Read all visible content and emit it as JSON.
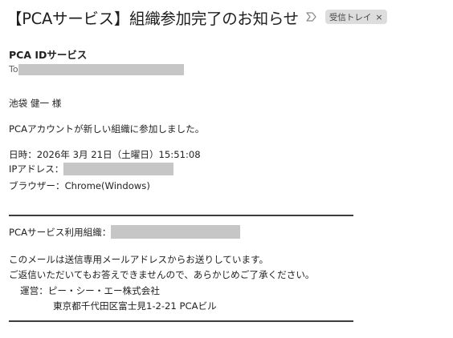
{
  "subject": "【PCAサービス】組織参加完了のお知らせ",
  "label_chip": {
    "text": "受信トレイ",
    "remove": "×"
  },
  "sender": {
    "name": "PCA IDサービス",
    "to_label": "To"
  },
  "body": {
    "greeting": "池袋 健一 様",
    "message": "PCAアカウントが新しい組織に参加しました。",
    "datetime": "日時：2026年 3月 21日（土曜日）15:51:08",
    "ip_label": "IPアドレス：",
    "browser": "ブラウザー：Chrome(Windows)",
    "org_label": "PCAサービス利用組織：",
    "notice_1": "このメールは送信専用メールアドレスからお送りしています。",
    "notice_2": "ご返信いただいてもお答えできませんので、あらかじめご了承ください。",
    "operator": "運営：ピー・シー・エー株式会社",
    "address": "東京都千代田区富士見1-2-21 PCAビル"
  },
  "colors": {
    "redaction": "#c6c6c6",
    "chip_background": "#dddddd",
    "rule": "#3c3c3c"
  }
}
